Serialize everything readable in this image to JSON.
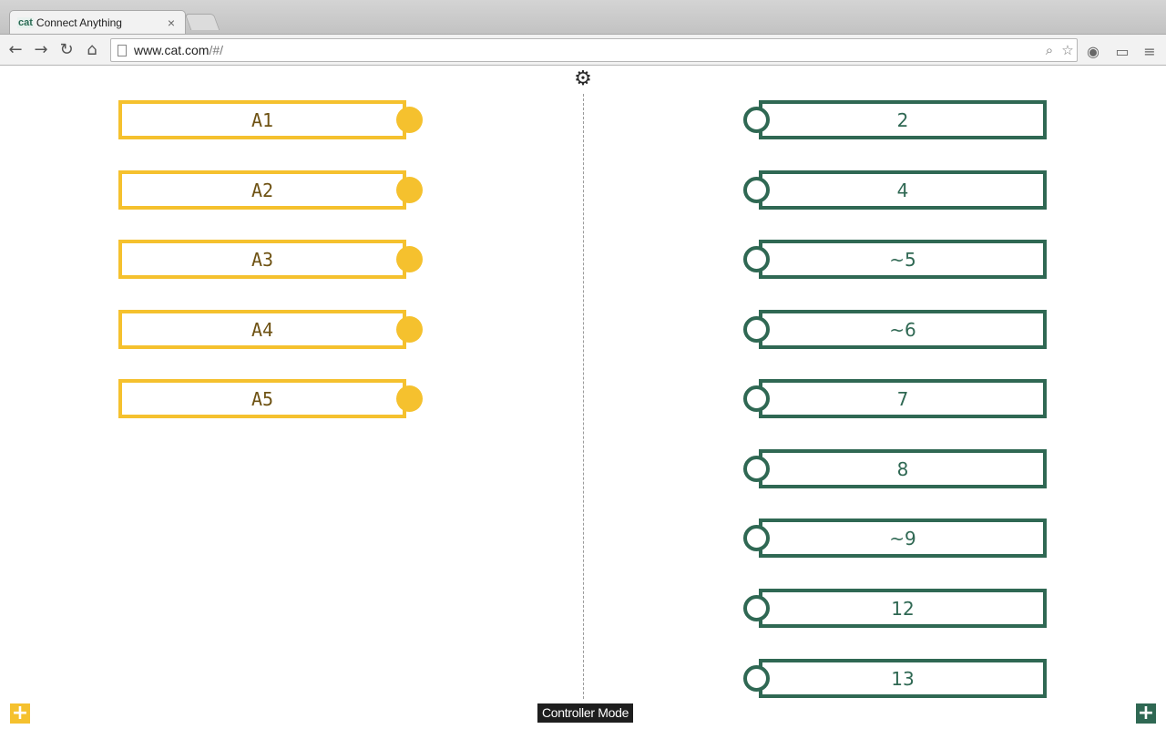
{
  "browser": {
    "tab": {
      "favicon_text": "cat",
      "title": "Connect Anything",
      "close_glyph": "×"
    },
    "url": {
      "host": "www.cat.com",
      "path": "/#/"
    }
  },
  "settings_icon": "gear-icon",
  "inputs": [
    {
      "label": "A1"
    },
    {
      "label": "A2"
    },
    {
      "label": "A3"
    },
    {
      "label": "A4"
    },
    {
      "label": "A5"
    }
  ],
  "outputs": [
    {
      "label": "2"
    },
    {
      "label": "4"
    },
    {
      "label": "~5"
    },
    {
      "label": "~6"
    },
    {
      "label": "7"
    },
    {
      "label": "8"
    },
    {
      "label": "~9"
    },
    {
      "label": "12"
    },
    {
      "label": "13"
    }
  ],
  "mode_label": "Controller Mode",
  "colors": {
    "input_accent": "#f5c12e",
    "input_text": "#6e5213",
    "output_accent": "#2f6853"
  }
}
